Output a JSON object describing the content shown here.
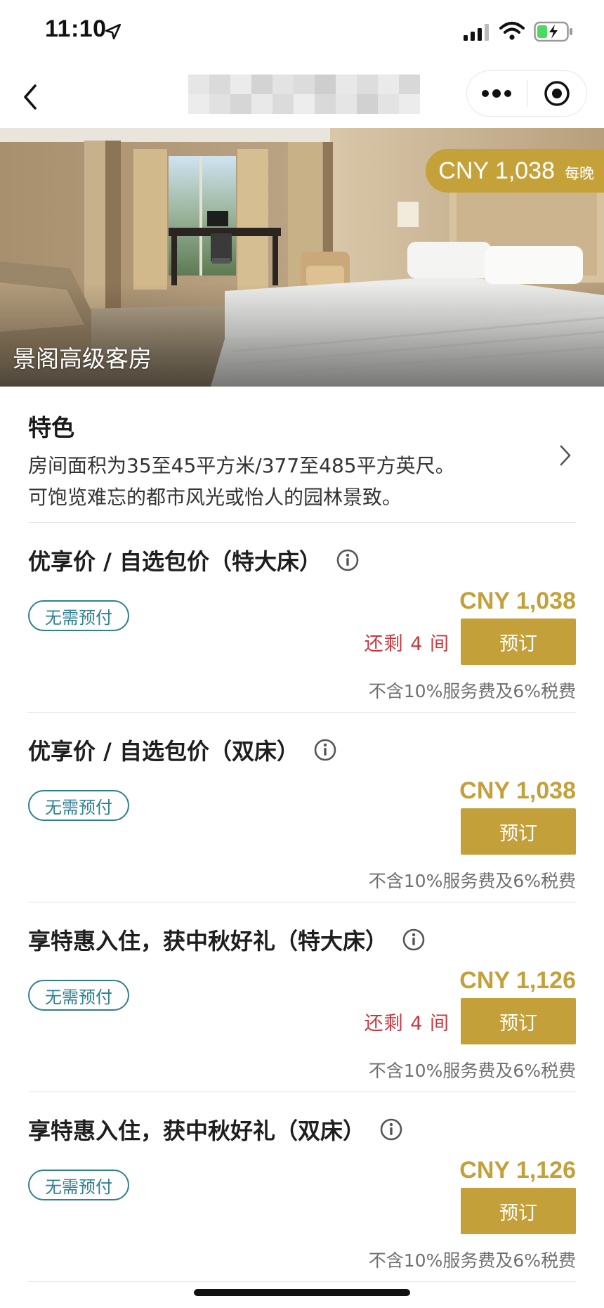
{
  "status_bar": {
    "time": "11:10"
  },
  "hero": {
    "price": "CNY 1,038",
    "price_unit": "每晚",
    "room_name": "景阁高级客房"
  },
  "features": {
    "heading": "特色",
    "lines": [
      "房间面积为35至45平方米/377至485平方英尺。",
      "可饱览难忘的都市风光或怡人的园林景致。"
    ]
  },
  "rates": [
    {
      "title": "优享价 / 自选包价（特大床）",
      "badge": "无需预付",
      "price": "CNY 1,038",
      "remaining": "还剩 4 间",
      "book": "预订",
      "note": "不含10%服务费及6%税费"
    },
    {
      "title": "优享价 / 自选包价（双床）",
      "badge": "无需预付",
      "price": "CNY 1,038",
      "remaining": "",
      "book": "预订",
      "note": "不含10%服务费及6%税费"
    },
    {
      "title": "享特惠入住，获中秋好礼（特大床）",
      "badge": "无需预付",
      "price": "CNY 1,126",
      "remaining": "还剩 4 间",
      "book": "预订",
      "note": "不含10%服务费及6%税费"
    },
    {
      "title": "享特惠入住，获中秋好礼（双床）",
      "badge": "无需预付",
      "price": "CNY 1,126",
      "remaining": "",
      "book": "预订",
      "note": "不含10%服务费及6%税费"
    }
  ],
  "colors": {
    "gold": "#c4a03a",
    "teal": "#2f7f91",
    "red": "#c8373e"
  },
  "icons": {
    "back": "chevron-left-icon",
    "more": "more-dots-icon",
    "close": "target-close-icon",
    "info": "info-circle-icon",
    "features_chevron": "chevron-right-icon"
  }
}
